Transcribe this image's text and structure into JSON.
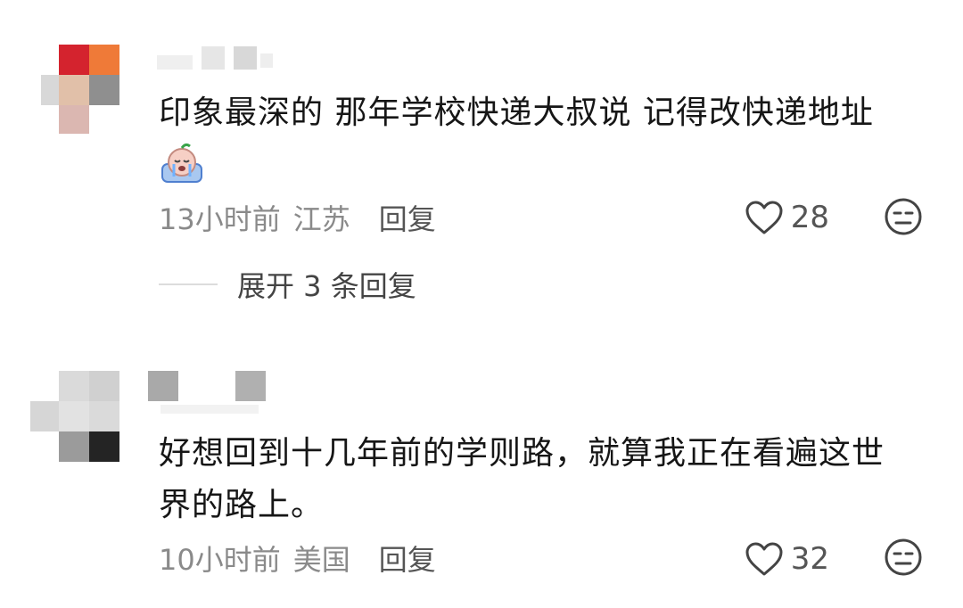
{
  "comments": [
    {
      "username": "",
      "text": "印象最深的 那年学校快递大叔说 记得改快递地址",
      "emoji": "crying-face-emoji",
      "time": "13小时前",
      "location": "江苏",
      "reply_label": "回复",
      "likes": "28",
      "expand_label": "展开 3 条回复"
    },
    {
      "username": "",
      "text": "好想回到十几年前的学则路，就算我正在看遍这世界的路上。",
      "time": "10小时前",
      "location": "美国",
      "reply_label": "回复",
      "likes": "32"
    }
  ],
  "icons": {
    "like": "heart-outline-icon",
    "dislike": "dislike-face-icon"
  },
  "colors": {
    "text": "#161616",
    "meta": "#8a8a8a",
    "icon": "#444444"
  }
}
